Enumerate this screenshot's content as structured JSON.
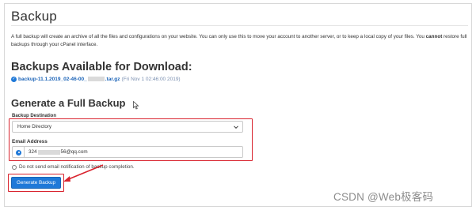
{
  "page": {
    "title": "Backup",
    "description_part1": "A full backup will create an archive of all the files and configurations on your website. You can only use this to move your account to another server, or to keep a local copy of your files. You ",
    "description_bold": "cannot",
    "description_part2": " restore full backups through your cPanel interface."
  },
  "available": {
    "heading": "Backups Available for Download:",
    "backup_link_prefix": "backup-11.1.2019_02-46-00_",
    "backup_link_suffix": ".tar.gz",
    "backup_date": "(Fri Nov 1 02:46:00 2019)"
  },
  "generate": {
    "heading": "Generate a Full Backup",
    "destination_label": "Backup Destination",
    "destination_value": "Home Directory",
    "email_label": "Email Address",
    "email_prefix": "324",
    "email_suffix": "56@qq.com",
    "no_email_label": "Do not send email notification of backup completion.",
    "button_label": "Generate Backup"
  },
  "colors": {
    "accent": "#1f79d8",
    "highlight": "#d9232e"
  },
  "watermark": "CSDN @Web极客码"
}
